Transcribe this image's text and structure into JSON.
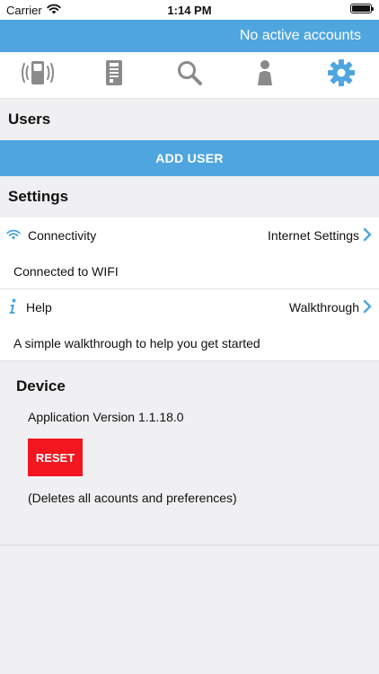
{
  "status_bar": {
    "carrier": "Carrier",
    "time": "1:14 PM"
  },
  "header": {
    "accounts_status": "No active accounts"
  },
  "tabs": [
    {
      "icon": "intercom-icon"
    },
    {
      "icon": "door-panel-icon"
    },
    {
      "icon": "search-icon"
    },
    {
      "icon": "person-icon"
    },
    {
      "icon": "gear-icon",
      "active": true
    }
  ],
  "users": {
    "title": "Users",
    "add_user_label": "ADD USER"
  },
  "settings": {
    "title": "Settings",
    "connectivity": {
      "label": "Connectivity",
      "link": "Internet Settings",
      "status": "Connected to WIFI"
    },
    "help": {
      "label": "Help",
      "link": "Walkthrough",
      "description": "A simple walkthrough to help you get started"
    }
  },
  "device": {
    "title": "Device",
    "app_version": "Application Version 1.1.18.0",
    "reset_label": "RESET",
    "reset_note": "(Deletes all acounts and preferences)"
  },
  "colors": {
    "accent": "#4fa6df",
    "danger": "#f2161e",
    "icon_gray": "#8a8a8a"
  }
}
